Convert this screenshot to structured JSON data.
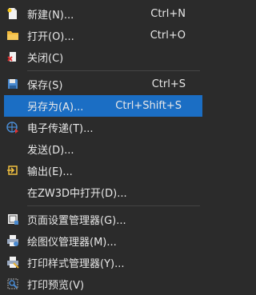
{
  "menu": {
    "items": [
      {
        "label": "新建(N)...",
        "shortcut": "Ctrl+N",
        "icon": "new-file-icon"
      },
      {
        "label": "打开(O)...",
        "shortcut": "Ctrl+O",
        "icon": "open-folder-icon"
      },
      {
        "label": "关闭(C)",
        "shortcut": "",
        "icon": "close-file-icon"
      },
      {
        "label": "保存(S)",
        "shortcut": "Ctrl+S",
        "icon": "save-icon"
      },
      {
        "label": "另存为(A)...",
        "shortcut": "Ctrl+Shift+S",
        "icon": ""
      },
      {
        "label": "电子传递(T)...",
        "shortcut": "",
        "icon": "etransmit-globe-icon"
      },
      {
        "label": "发送(D)...",
        "shortcut": "",
        "icon": ""
      },
      {
        "label": "输出(E)...",
        "shortcut": "",
        "icon": "export-icon"
      },
      {
        "label": "在ZW3D中打开(D)...",
        "shortcut": "",
        "icon": ""
      },
      {
        "label": "页面设置管理器(G)...",
        "shortcut": "",
        "icon": "page-setup-icon"
      },
      {
        "label": "绘图仪管理器(M)...",
        "shortcut": "",
        "icon": "plotter-icon"
      },
      {
        "label": "打印样式管理器(Y)...",
        "shortcut": "",
        "icon": "print-style-icon"
      },
      {
        "label": "打印预览(V)",
        "shortcut": "",
        "icon": "print-preview-icon"
      }
    ]
  },
  "colors": {
    "background": "#2b2b2b",
    "selected": "#1b6ec4",
    "text": "#e8e8e8"
  }
}
